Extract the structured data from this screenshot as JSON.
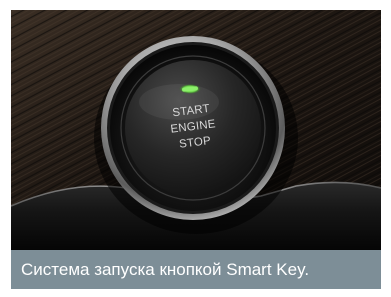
{
  "image": {
    "subject": "engine start stop push button",
    "colors": {
      "wood_dark": "#1a1410",
      "wood_light": "#3a2e24",
      "chrome": "#c9c9c9",
      "button_face": "#2a2a2a",
      "indicator": "#6cd84a",
      "caption_bg": "#7d8e97"
    },
    "button_label": {
      "line1": "START",
      "line2": "ENGINE",
      "line3": "STOP"
    }
  },
  "caption": {
    "text": "Система запуска кнопкой Smart Key."
  }
}
